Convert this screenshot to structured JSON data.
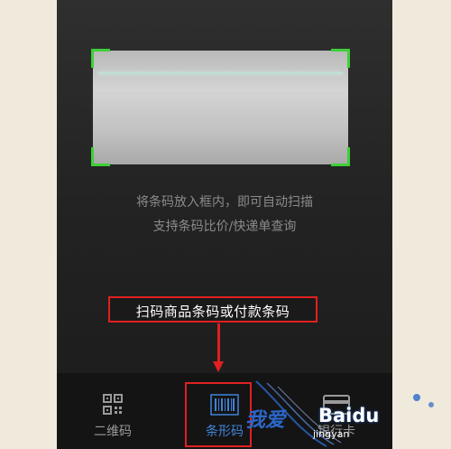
{
  "scanner": {
    "hint_line1": "将条码放入框内，即可自动扫描",
    "hint_line2": "支持条码比价/快递单查询"
  },
  "annotation": {
    "text": "扫码商品条码或付款条码"
  },
  "tabs": [
    {
      "label": "二维码",
      "icon": "qr-code-icon"
    },
    {
      "label": "条形码",
      "icon": "barcode-icon",
      "active": true
    },
    {
      "label": "银行卡",
      "icon": "card-icon"
    }
  ],
  "watermark": {
    "text_main": "我爱",
    "text_brand": "Baidu",
    "text_sub": "jingyan"
  },
  "colors": {
    "corner_green": "#3dd138",
    "annotation_red": "#e02020",
    "active_tab_blue": "#3f83d8"
  }
}
